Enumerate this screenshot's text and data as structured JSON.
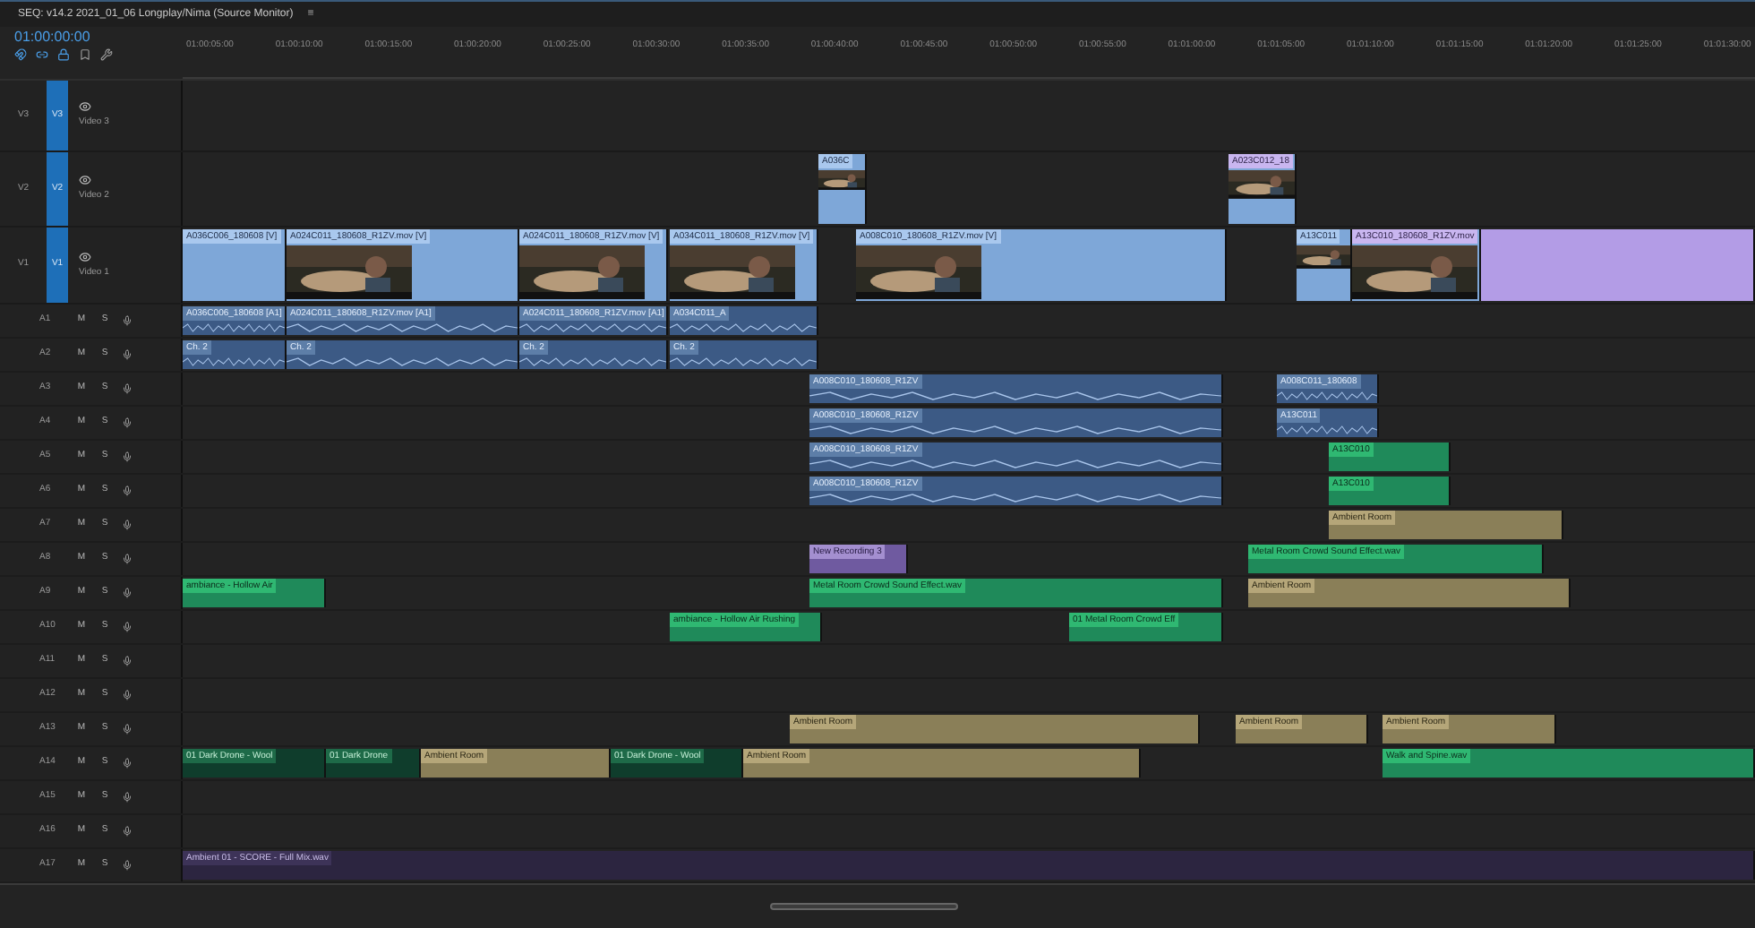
{
  "sequence_tab": {
    "title": "SEQ: v14.2 2021_01_06 Longplay/Nima (Source Monitor)",
    "menu": "≡"
  },
  "timecode": "01:00:00:00",
  "ruler": [
    "01:00:05:00",
    "01:00:10:00",
    "01:00:15:00",
    "01:00:20:00",
    "01:00:25:00",
    "01:00:30:00",
    "01:00:35:00",
    "01:00:40:00",
    "01:00:45:00",
    "01:00:50:00",
    "01:00:55:00",
    "01:01:00:00",
    "01:01:05:00",
    "01:01:10:00",
    "01:01:15:00",
    "01:01:20:00",
    "01:01:25:00",
    "01:01:30:00"
  ],
  "video_tracks": [
    {
      "label": "V3",
      "patch": "V3",
      "name": "Video 3"
    },
    {
      "label": "V2",
      "patch": "V2",
      "name": "Video 2",
      "clips": [
        {
          "kind": "video",
          "name": "A036C",
          "thumbnail": true
        },
        {
          "kind": "video_alt",
          "name": "A023C012_18",
          "thumbnail": true
        }
      ]
    },
    {
      "label": "V1",
      "patch": "V1",
      "name": "Video 1",
      "clips": [
        {
          "kind": "video",
          "name": "A036C006_180608 [V]",
          "thumbnail": false
        },
        {
          "kind": "video",
          "name": "A024C011_180608_R1ZV.mov [V]",
          "thumbnail": true
        },
        {
          "kind": "video",
          "name": "A024C011_180608_R1ZV.mov [V]",
          "thumbnail": true
        },
        {
          "kind": "video",
          "name": "A034C011_180608_R1ZV.mov [V]",
          "thumbnail": true
        },
        {
          "kind": "video",
          "name": "A008C010_180608_R1ZV.mov [V]",
          "thumbnail": true
        },
        {
          "kind": "video",
          "name": "A13C011",
          "thumbnail": true
        },
        {
          "kind": "video_alt",
          "name": "A13C010_180608_R1ZV.mov",
          "thumbnail": true
        },
        {
          "kind": "adjustment",
          "thumbnail": false
        }
      ]
    }
  ],
  "audio_tracks": [
    {
      "label": "A1",
      "mute": "M",
      "solo": "S",
      "clips": [
        {
          "kind": "audio",
          "name": "A036C006_180608 [A1]"
        },
        {
          "kind": "audio",
          "name": "A024C011_180608_R1ZV.mov [A1]"
        },
        {
          "kind": "audio",
          "name": "A024C011_180608_R1ZV.mov [A1]"
        },
        {
          "kind": "audio",
          "name": "A034C011_A"
        }
      ]
    },
    {
      "label": "A2",
      "mute": "M",
      "solo": "S",
      "clips": [
        {
          "kind": "audio",
          "name": "Ch. 2"
        },
        {
          "kind": "audio",
          "name": "Ch. 2"
        },
        {
          "kind": "audio",
          "name": "Ch. 2"
        },
        {
          "kind": "audio",
          "name": "Ch. 2"
        }
      ]
    },
    {
      "label": "A3",
      "mute": "M",
      "solo": "S",
      "clips": [
        {
          "kind": "audio",
          "name": "A008C010_180608_R1ZV"
        },
        {
          "kind": "audio",
          "name": "A008C011_180608"
        }
      ]
    },
    {
      "label": "A4",
      "mute": "M",
      "solo": "S",
      "clips": [
        {
          "kind": "audio",
          "name": "A008C010_180608_R1ZV"
        },
        {
          "kind": "audio",
          "name": "A13C011"
        }
      ]
    },
    {
      "label": "A5",
      "mute": "M",
      "solo": "S",
      "clips": [
        {
          "kind": "audio",
          "name": "A008C010_180608_R1ZV"
        },
        {
          "kind": "sfx",
          "name": "A13C010"
        }
      ]
    },
    {
      "label": "A6",
      "mute": "M",
      "solo": "S",
      "clips": [
        {
          "kind": "audio",
          "name": "A008C010_180608_R1ZV"
        },
        {
          "kind": "sfx",
          "name": "A13C010"
        }
      ]
    },
    {
      "label": "A7",
      "mute": "M",
      "solo": "S",
      "clips": [
        {
          "kind": "ambience",
          "name": "Ambient Room"
        }
      ]
    },
    {
      "label": "A8",
      "mute": "M",
      "solo": "S",
      "clips": [
        {
          "kind": "recording",
          "name": "New Recording 3"
        },
        {
          "kind": "sfx",
          "name": "Metal Room Crowd Sound Effect.wav"
        }
      ]
    },
    {
      "label": "A9",
      "mute": "M",
      "solo": "S",
      "clips": [
        {
          "kind": "sfx",
          "name": "ambiance - Hollow Air"
        },
        {
          "kind": "sfx",
          "name": "Metal Room Crowd Sound Effect.wav"
        },
        {
          "kind": "ambience",
          "name": "Ambient Room"
        }
      ]
    },
    {
      "label": "A10",
      "mute": "M",
      "solo": "S",
      "clips": [
        {
          "kind": "sfx",
          "name": "ambiance - Hollow Air Rushing"
        },
        {
          "kind": "sfx",
          "name": "01 Metal Room Crowd Eff"
        }
      ]
    },
    {
      "label": "A11",
      "mute": "M",
      "solo": "S"
    },
    {
      "label": "A12",
      "mute": "M",
      "solo": "S"
    },
    {
      "label": "A13",
      "mute": "M",
      "solo": "S",
      "clips": [
        {
          "kind": "ambience",
          "name": "Ambient Room"
        },
        {
          "kind": "ambience",
          "name": "Ambient Room"
        },
        {
          "kind": "ambience",
          "name": "Ambient Room"
        }
      ]
    },
    {
      "label": "A14",
      "mute": "M",
      "solo": "S",
      "clips": [
        {
          "kind": "music",
          "name": "01 Dark Drone - Wool"
        },
        {
          "kind": "music",
          "name": "01 Dark Drone"
        },
        {
          "kind": "ambience",
          "name": "Ambient Room"
        },
        {
          "kind": "music",
          "name": "01 Dark Drone - Wool"
        },
        {
          "kind": "ambience",
          "name": "Ambient Room"
        },
        {
          "kind": "sfx",
          "name": "Walk and Spine.wav"
        }
      ]
    },
    {
      "label": "A15",
      "mute": "M",
      "solo": "S"
    },
    {
      "label": "A16",
      "mute": "M",
      "solo": "S"
    },
    {
      "label": "A17",
      "mute": "M",
      "solo": "S",
      "clips": [
        {
          "kind": "score",
          "name": "Ambient 01 - SCORE - Full Mix.wav"
        }
      ]
    }
  ]
}
